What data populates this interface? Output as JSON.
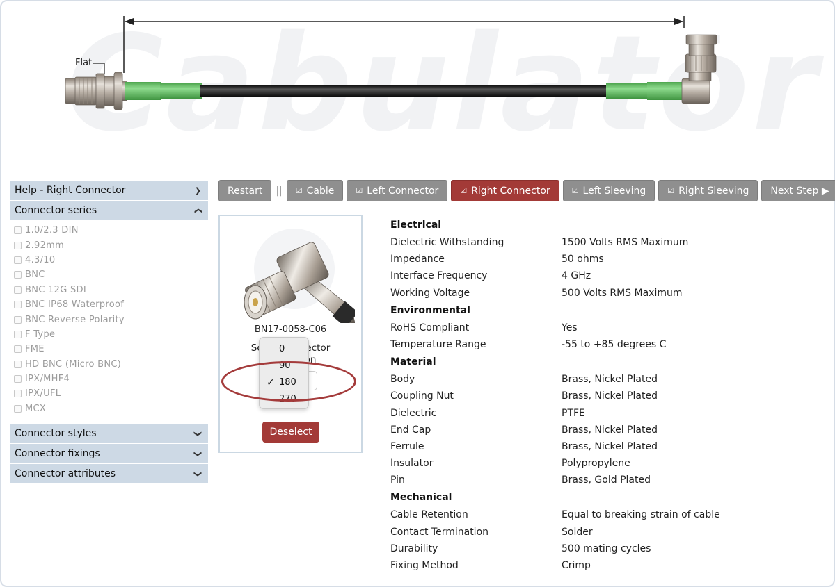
{
  "diagram": {
    "watermark": "Cabulator",
    "watermark_tm": "™",
    "flat_label": "Flat"
  },
  "sidebar": {
    "help_title": "Help - Right Connector",
    "series_title": "Connector series",
    "series_items": [
      "1.0/2.3 DIN",
      "2.92mm",
      "4.3/10",
      "BNC",
      "BNC 12G SDI",
      "BNC IP68 Waterproof",
      "BNC Reverse Polarity",
      "F Type",
      "FME",
      "HD BNC (Micro BNC)",
      "IPX/MHF4",
      "IPX/UFL",
      "MCX"
    ],
    "styles_title": "Connector styles",
    "fixings_title": "Connector fixings",
    "attributes_title": "Connector attributes"
  },
  "steps": {
    "restart": "Restart",
    "separator": "||",
    "cable": "Cable",
    "left_connector": "Left Connector",
    "right_connector": "Right Connector",
    "left_sleeving": "Left Sleeving",
    "right_sleeving": "Right Sleeving",
    "next_step": "Next Step ▶",
    "tick": "☑"
  },
  "card": {
    "part_number": "BN17-0058-C06",
    "desc_line1": "Select connector",
    "desc_line2": "orientation",
    "deselect": "Deselect"
  },
  "dropdown": {
    "options": [
      "0",
      "90",
      "180",
      "270"
    ],
    "selected": "180",
    "check": "✓"
  },
  "specs": {
    "electrical": {
      "title": "Electrical",
      "rows": [
        {
          "k": "Dielectric Withstanding",
          "v": "1500 Volts RMS Maximum"
        },
        {
          "k": "Impedance",
          "v": "50 ohms"
        },
        {
          "k": "Interface Frequency",
          "v": "4 GHz"
        },
        {
          "k": "Working Voltage",
          "v": "500 Volts RMS Maximum"
        }
      ]
    },
    "environmental": {
      "title": "Environmental",
      "rows": [
        {
          "k": "RoHS Compliant",
          "v": "Yes"
        },
        {
          "k": "Temperature Range",
          "v": "-55 to +85 degrees C"
        }
      ]
    },
    "material": {
      "title": "Material",
      "rows": [
        {
          "k": "Body",
          "v": "Brass, Nickel Plated"
        },
        {
          "k": "Coupling Nut",
          "v": "Brass, Nickel Plated"
        },
        {
          "k": "Dielectric",
          "v": "PTFE"
        },
        {
          "k": "End Cap",
          "v": "Brass, Nickel Plated"
        },
        {
          "k": "Ferrule",
          "v": "Brass, Nickel Plated"
        },
        {
          "k": "Insulator",
          "v": "Polypropylene"
        },
        {
          "k": "Pin",
          "v": "Brass, Gold Plated"
        }
      ]
    },
    "mechanical": {
      "title": "Mechanical",
      "rows": [
        {
          "k": "Cable Retention",
          "v": "Equal to breaking strain of cable"
        },
        {
          "k": "Contact Termination",
          "v": "Solder"
        },
        {
          "k": "Durability",
          "v": "500 mating cycles"
        },
        {
          "k": "Fixing Method",
          "v": "Crimp"
        }
      ]
    }
  },
  "colors": {
    "accent": "#a33a37",
    "sidebar_header": "#cdd9e5",
    "sleeve_green": "#6cc26c",
    "cable_black": "#1e1e1e"
  }
}
